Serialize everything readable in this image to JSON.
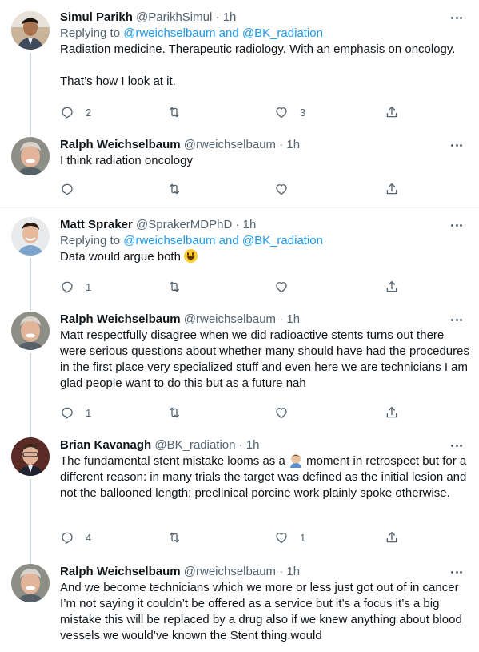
{
  "tweets": [
    {
      "name": "Simul Parikh",
      "handle": "@ParikhSimul",
      "time": "1h",
      "replying_prefix": "Replying to ",
      "replying_targets": "@rweichselbaum and @BK_radiation",
      "text": "Radiation medicine. Therapeutic radiology. With an emphasis on oncology.\n\nThat’s how I look at it.",
      "replies": "2",
      "retweets": "",
      "likes": "3"
    },
    {
      "name": "Ralph Weichselbaum",
      "handle": "@rweichselbaum",
      "time": "1h",
      "text": "I think radiation oncology",
      "replies": "",
      "retweets": "",
      "likes": ""
    },
    {
      "name": "Matt Spraker",
      "handle": "@SprakerMDPhD",
      "time": "1h",
      "replying_prefix": "Replying to ",
      "replying_targets": "@rweichselbaum and @BK_radiation",
      "text": "Data would argue both ",
      "replies": "1",
      "retweets": "",
      "likes": ""
    },
    {
      "name": "Ralph Weichselbaum",
      "handle": "@rweichselbaum",
      "time": "1h",
      "text": "Matt respectfully disagree when we did radioactive stents turns out there were serious questions about whether many should have had the procedures in the first place very specialized stuff and even here we are technicians I am glad people want to do this but as a future nah",
      "replies": "1",
      "retweets": "",
      "likes": ""
    },
    {
      "name": "Brian Kavanagh",
      "handle": "@BK_radiation",
      "time": "1h",
      "text_before": "The fundamental stent mistake looms as a ",
      "text_after": " moment in retrospect but for a different reason: in many trials the target was defined as the initial lesion and not the ballooned length; preclinical porcine work plainly spoke otherwise.",
      "replies": "4",
      "retweets": "",
      "likes": "1"
    },
    {
      "name": "Ralph Weichselbaum",
      "handle": "@rweichselbaum",
      "time": "1h",
      "text": "And we become technicians which we more or less just got out of in cancer I’m not saying it couldn’t be offered as a service but it’s a focus it’s a big mistake this will be replaced by a drug also if we knew anything about blood vessels we would’ve known the Stent thing.would",
      "replies": "",
      "retweets": "",
      "likes": ""
    }
  ],
  "separator": "·",
  "icons": {
    "reply": "reply-icon",
    "retweet": "retweet-icon",
    "like": "heart-icon",
    "share": "share-icon",
    "more": "more-icon"
  },
  "colors": {
    "link": "#1d9bf0",
    "secondary": "#536471",
    "primary": "#0f1419",
    "thread_line": "#cfd9de"
  }
}
